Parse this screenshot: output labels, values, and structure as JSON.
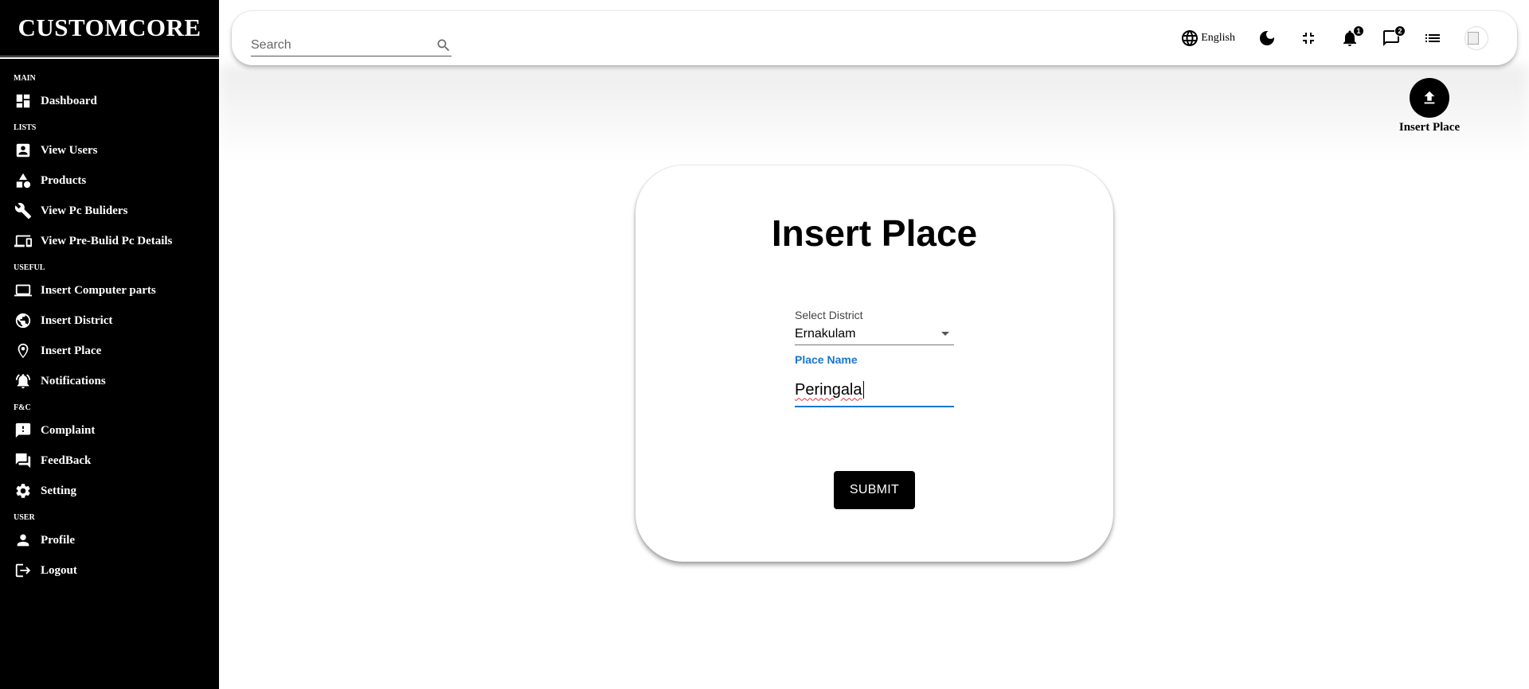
{
  "app": {
    "logo": "CUSTOMCORE"
  },
  "sidebar": {
    "sections": [
      {
        "title": "MAIN",
        "items": [
          {
            "label": "Dashboard",
            "icon": "dashboard-icon"
          }
        ]
      },
      {
        "title": "LISTS",
        "items": [
          {
            "label": "View Users",
            "icon": "account-box-icon"
          },
          {
            "label": "Products",
            "icon": "category-icon"
          },
          {
            "label": "View Pc Buliders",
            "icon": "wrench-icon"
          },
          {
            "label": "View Pre-Bulid Pc Details",
            "icon": "devices-icon"
          }
        ]
      },
      {
        "title": "USEFUL",
        "items": [
          {
            "label": "Insert Computer parts",
            "icon": "laptop-icon"
          },
          {
            "label": "Insert District",
            "icon": "globe-icon"
          },
          {
            "label": "Insert Place",
            "icon": "location-pin-icon"
          },
          {
            "label": "Notifications",
            "icon": "notification-bell-icon"
          }
        ]
      },
      {
        "title": "F&C",
        "items": [
          {
            "label": "Complaint",
            "icon": "feedback-icon"
          },
          {
            "label": "FeedBack",
            "icon": "forum-icon"
          },
          {
            "label": "Setting",
            "icon": "gear-icon"
          }
        ]
      },
      {
        "title": "USER",
        "items": [
          {
            "label": "Profile",
            "icon": "person-icon"
          },
          {
            "label": "Logout",
            "icon": "logout-icon"
          }
        ]
      }
    ]
  },
  "topbar": {
    "search_placeholder": "Search",
    "language": "English",
    "notifications_count": "1",
    "messages_count": "2"
  },
  "page_action": {
    "label": "Insert Place"
  },
  "form": {
    "title": "Insert Place",
    "district_label": "Select District",
    "district_value": "Ernakulam",
    "place_label": "Place Name",
    "place_value": "Peringala",
    "submit_label": "SUBMIT"
  }
}
